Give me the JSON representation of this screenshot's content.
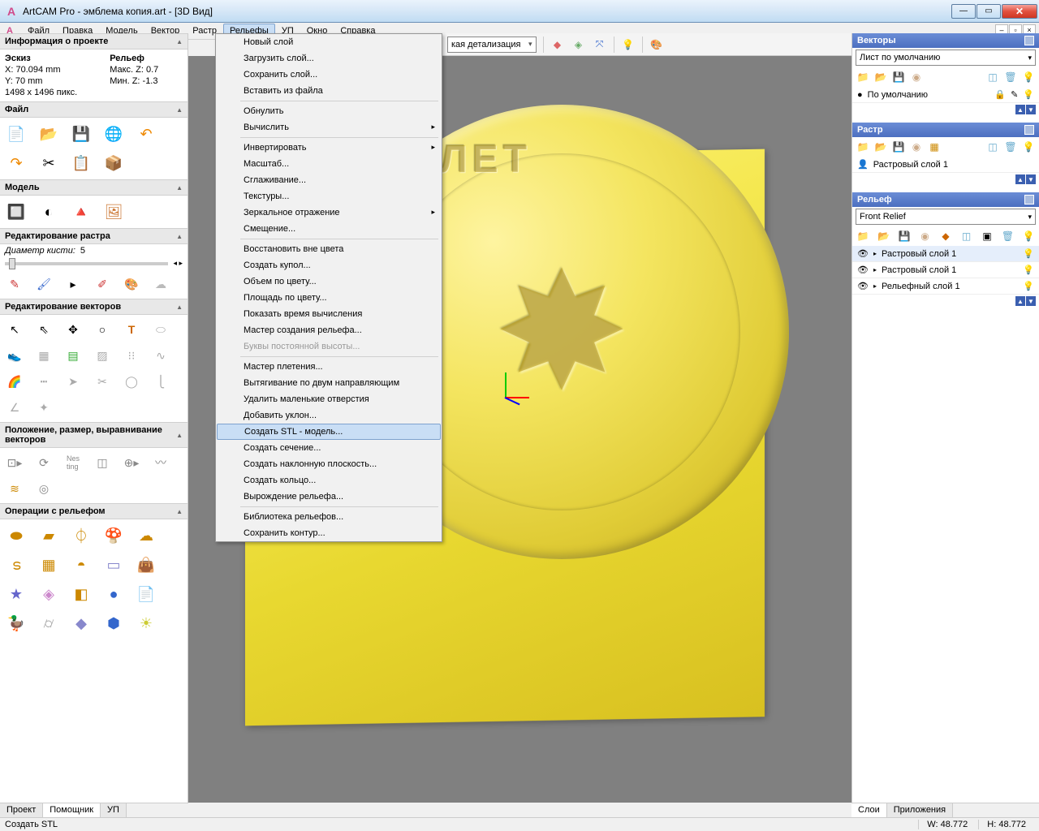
{
  "title": "ArtCAM Pro - эмблема копия.art - [3D Вид]",
  "menu": {
    "items": [
      "Файл",
      "Правка",
      "Модель",
      "Вектор",
      "Растр",
      "Рельефы",
      "УП",
      "Окно",
      "Справка"
    ],
    "open_index": 5
  },
  "dropdown": [
    {
      "t": "Новый слой"
    },
    {
      "t": "Загрузить слой..."
    },
    {
      "t": "Сохранить слой..."
    },
    {
      "t": "Вставить из файла"
    },
    {
      "sep": true
    },
    {
      "t": "Обнулить"
    },
    {
      "t": "Вычислить",
      "sub": true
    },
    {
      "sep": true
    },
    {
      "t": "Инвертировать",
      "sub": true
    },
    {
      "t": "Масштаб..."
    },
    {
      "t": "Сглаживание..."
    },
    {
      "t": "Текстуры..."
    },
    {
      "t": "Зеркальное отражение",
      "sub": true
    },
    {
      "t": "Смещение..."
    },
    {
      "sep": true
    },
    {
      "t": "Восстановить вне цвета"
    },
    {
      "t": "Создать купол..."
    },
    {
      "t": "Объем по цвету..."
    },
    {
      "t": "Площадь по цвету..."
    },
    {
      "t": "Показать время вычисления"
    },
    {
      "t": "Мастер создания рельефа..."
    },
    {
      "t": "Буквы постоянной высоты...",
      "disabled": true
    },
    {
      "sep": true
    },
    {
      "t": "Мастер плетения..."
    },
    {
      "t": "Вытягивание по двум направляющим"
    },
    {
      "t": "Удалить маленькие отверстия"
    },
    {
      "t": "Добавить уклон..."
    },
    {
      "t": "Создать STL - модель...",
      "hover": true
    },
    {
      "t": "Создать сечение..."
    },
    {
      "t": "Создать наклонную плоскость..."
    },
    {
      "t": "Создать кольцо..."
    },
    {
      "t": "Вырождение рельефа..."
    },
    {
      "sep": true
    },
    {
      "t": "Библиотека рельефов..."
    },
    {
      "t": "Сохранить контур..."
    }
  ],
  "toolbar": {
    "detail": "кая детализация"
  },
  "left": {
    "info_header": "Информация о проекте",
    "sketch_label": "Эскиз",
    "relief_label": "Рельеф",
    "x": "X: 70.094 mm",
    "y": "Y: 70 mm",
    "maxz": "Макс. Z: 0.7",
    "minz": "Мин. Z: -1.3",
    "dims": "1498 x 1496 пикс.",
    "file_header": "Файл",
    "model_header": "Модель",
    "raster_edit_header": "Редактирование растра",
    "brush_label": "Диаметр кисти:",
    "brush_value": "5",
    "vector_edit_header": "Редактирование векторов",
    "pos_header": "Положение, размер, выравнивание векторов",
    "relief_ops_header": "Операции с рельефом"
  },
  "right": {
    "vectors_header": "Векторы",
    "vectors_combo": "Лист по умолчанию",
    "vectors_layer": "По умолчанию",
    "raster_header": "Растр",
    "raster_layer": "Растровый слой 1",
    "relief_header": "Рельеф",
    "relief_combo": "Front Relief",
    "relief_layers": [
      "Растровый слой 1",
      "Растровый слой 1",
      "Рельефный слой 1"
    ]
  },
  "tabs_left": [
    "Проект",
    "Помощник",
    "УП"
  ],
  "tabs_right": [
    "Слои",
    "Приложения"
  ],
  "status": {
    "left": "Создать STL",
    "w": "W: 48.772",
    "h": "H: 48.772"
  },
  "coin_top": "ЛЕТ"
}
